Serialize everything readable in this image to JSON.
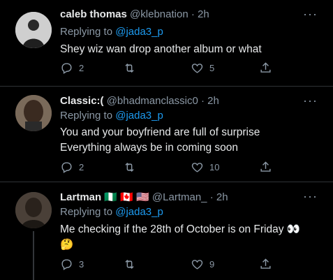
{
  "tweets": [
    {
      "name": "caleb thomas",
      "handle": "@klebnation",
      "time": "· 2h",
      "replying_prefix": "Replying to",
      "replying_to": "@jada3_p",
      "text_lines": [
        "Shey wiz wan drop another album or what"
      ],
      "replies": "2",
      "retweets": "",
      "likes": "5"
    },
    {
      "name": "Classic:(",
      "handle": "@bhadmanclassic0",
      "time": "· 2h",
      "replying_prefix": "Replying to",
      "replying_to": "@jada3_p",
      "text_lines": [
        "You and your boyfriend are full of surprise",
        "Everything always be in coming soon"
      ],
      "replies": "2",
      "retweets": "",
      "likes": "10"
    },
    {
      "name": "Lartman",
      "flags": "🇳🇬 🇨🇦 🇺🇸",
      "handle": "@Lartman_",
      "time": "· 2h",
      "replying_prefix": "Replying to",
      "replying_to": "@jada3_p",
      "text_lines": [
        "Me checking if the 28th of October is on Friday 👀",
        "🤔"
      ],
      "replies": "3",
      "retweets": "",
      "likes": "9"
    }
  ],
  "icons": {
    "reply": "reply-icon",
    "retweet": "retweet-icon",
    "like": "heart-icon",
    "share": "share-icon",
    "more": "more-icon"
  },
  "colors": {
    "background": "#000000",
    "link": "#1d9bf0",
    "muted": "#8b98a5"
  }
}
